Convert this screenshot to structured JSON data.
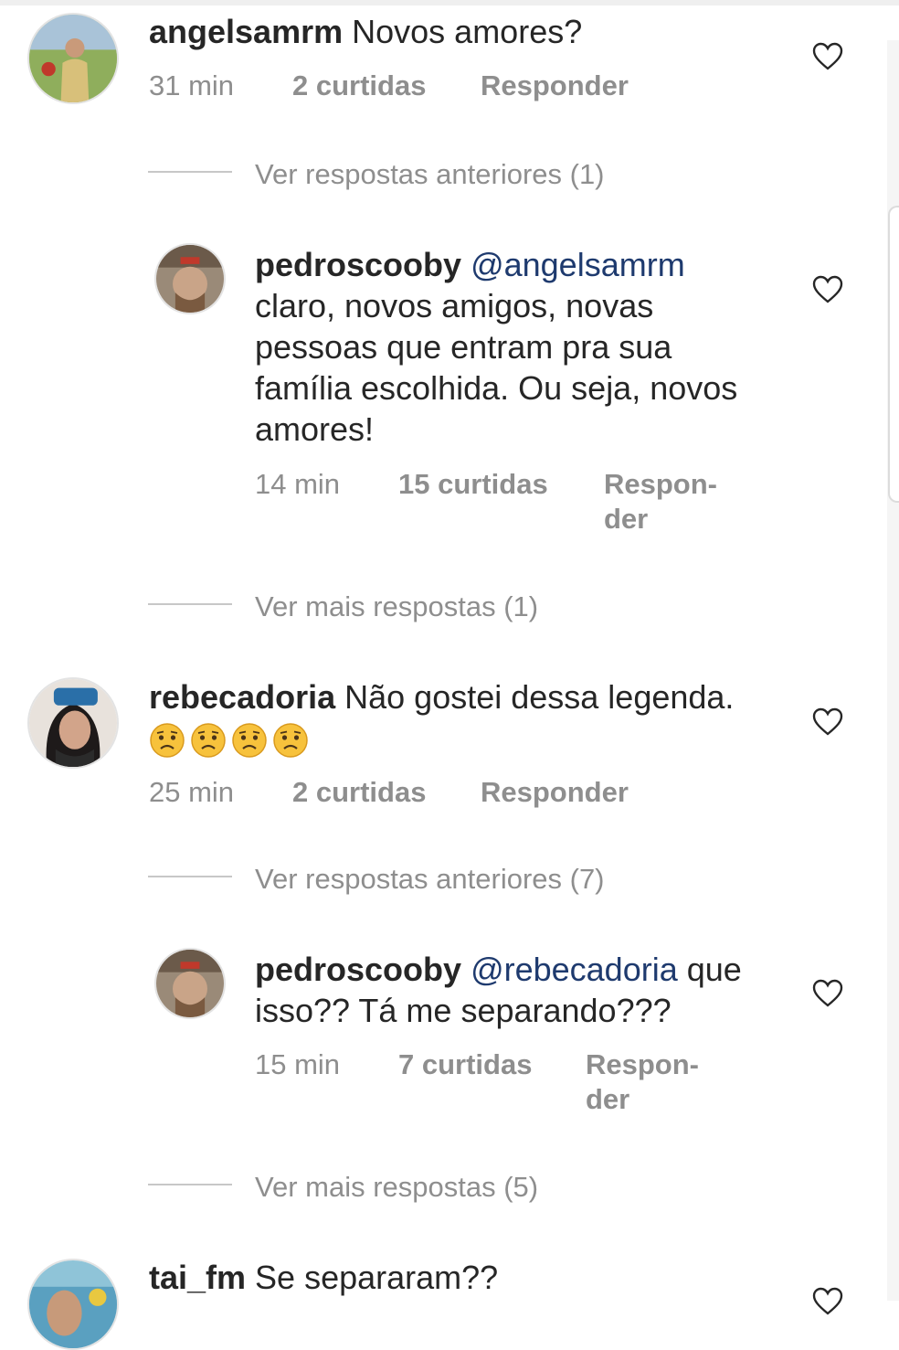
{
  "comments": [
    {
      "user": "angelsamrm",
      "text": "Novos amores?",
      "time": "31 min",
      "likes": "2 curtidas",
      "reply": "Responder"
    },
    {
      "previous_replies": "Ver respostas anteriores (1)",
      "reply": {
        "user": "pedroscooby",
        "mention": "@angelsamrm",
        "lines": [
          "claro, novos amigos, novas",
          "pessoas que entram pra sua",
          "família escolhida. Ou seja, novos",
          "amores!"
        ],
        "time": "14 min",
        "likes": "15 curtidas",
        "reply_lines": [
          "Respon-",
          "der"
        ]
      },
      "more_replies": "Ver mais respostas (1)"
    },
    {
      "user": "rebecadoria",
      "text": "Não gostei dessa legenda.",
      "emoji": "worried-face",
      "emoji_count": 4,
      "time": "25 min",
      "likes": "2 curtidas",
      "reply": "Responder"
    },
    {
      "previous_replies": "Ver respostas anteriores (7)",
      "reply": {
        "user": "pedroscooby",
        "mention": "@rebecadoria",
        "text_tail": "que",
        "line2": "isso?? Tá me separando???",
        "time": "15 min",
        "likes": "7 curtidas",
        "reply_lines": [
          "Respon-",
          "der"
        ]
      },
      "more_replies": "Ver mais respostas (5)"
    },
    {
      "user": "tai_fm",
      "text": "Se separaram??"
    }
  ],
  "colors": {
    "text": "#262626",
    "meta": "#8e8e8e",
    "mention": "#1e3a6e",
    "divider": "#c7c7c7"
  },
  "icons": {
    "like": "heart-outline-icon",
    "emoji": "worried-face"
  }
}
